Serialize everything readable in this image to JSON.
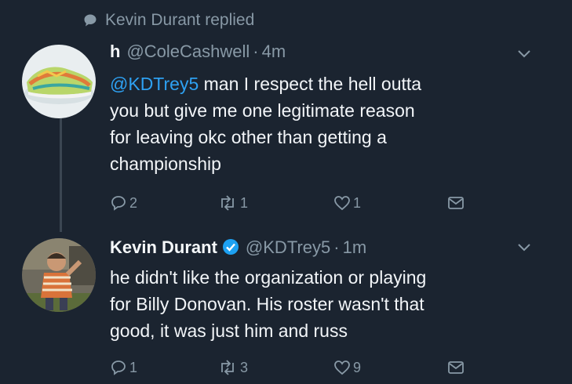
{
  "context": {
    "icon": "speech-bubble-icon",
    "text": "Kevin Durant replied"
  },
  "tweets": [
    {
      "display_name": "h",
      "handle": "@ColeCashwell",
      "separator": "·",
      "time": "4m",
      "avatar": "sneaker-avatar",
      "text_lines": [
        {
          "mention": "@KDTrey5",
          "rest": " man I respect the hell outta"
        },
        {
          "mention": "",
          "rest": "you but give me one legitimate reason"
        },
        {
          "mention": "",
          "rest": "for leaving okc other than getting a"
        },
        {
          "mention": "",
          "rest": "championship"
        }
      ],
      "counts": {
        "replies": "2",
        "retweets": "1",
        "likes": "1"
      }
    },
    {
      "display_name": "Kevin Durant",
      "verified": true,
      "handle": "@KDTrey5",
      "separator": "·",
      "time": "1m",
      "avatar": "child-photo-avatar",
      "text_lines": [
        {
          "mention": "",
          "rest": "he didn't like the organization or playing"
        },
        {
          "mention": "",
          "rest": "for Billy Donovan. His roster wasn't that"
        },
        {
          "mention": "",
          "rest": "good, it was just him and russ"
        }
      ],
      "counts": {
        "replies": "1",
        "retweets": "3",
        "likes": "9"
      }
    }
  ],
  "colors": {
    "background": "#1b2430",
    "muted": "#8899a6",
    "mention": "#2ea1f2",
    "verified": "#1da1f2"
  }
}
